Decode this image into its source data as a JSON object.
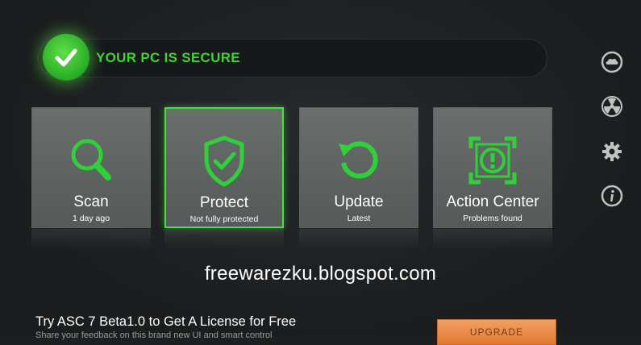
{
  "status": {
    "text": "YOUR PC IS SECURE",
    "accent": "#41d234",
    "icon": "checkmark-icon"
  },
  "tiles": [
    {
      "title": "Scan",
      "subtitle": "1 day ago",
      "icon": "magnifier-icon",
      "active": false
    },
    {
      "title": "Protect",
      "subtitle": "Not fully protected",
      "icon": "shield-check-icon",
      "active": true
    },
    {
      "title": "Update",
      "subtitle": "Latest",
      "icon": "refresh-icon",
      "active": false
    },
    {
      "title": "Action Center",
      "subtitle": "Problems found",
      "icon": "alert-center-icon",
      "active": false
    }
  ],
  "side_icons": [
    "cloud-icon",
    "radiation-icon",
    "gear-icon",
    "info-icon"
  ],
  "watermark": "freewarezku.blogspot.com",
  "promo": {
    "title": "Try ASC 7 Beta1.0 to Get A License for Free",
    "subtitle": "Share your feedback on this brand new UI and smart control",
    "button": "UPGRADE"
  },
  "colors": {
    "accent_green": "#48e23a",
    "tile_gray": "#5f6361",
    "upgrade_orange": "#e8894a"
  }
}
